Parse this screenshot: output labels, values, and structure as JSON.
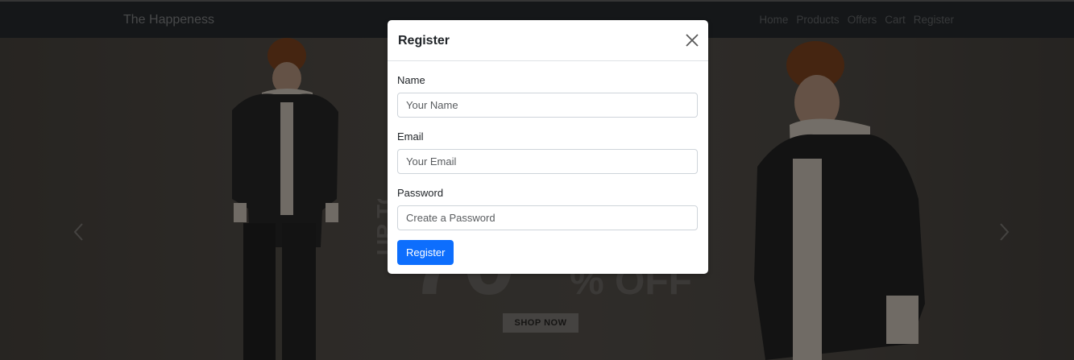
{
  "navbar": {
    "brand": "The Happeness",
    "links": [
      "Home",
      "Products",
      "Offers",
      "Cart",
      "Register"
    ]
  },
  "hero": {
    "banner_text_top": "UP TO",
    "banner_text_big": "70",
    "banner_text_off": "% OFF",
    "shop_now": "SHOP NOW",
    "prev_icon": "chevron-left-icon",
    "next_icon": "chevron-right-icon"
  },
  "modal": {
    "title": "Register",
    "close_icon": "close-icon",
    "fields": {
      "name": {
        "label": "Name",
        "placeholder": "Your Name"
      },
      "email": {
        "label": "Email",
        "placeholder": "Your Email"
      },
      "password": {
        "label": "Password",
        "placeholder": "Create a Password"
      }
    },
    "submit_label": "Register"
  },
  "colors": {
    "navbar_bg": "#2b2f33",
    "primary": "#0d6efd",
    "overlay": "rgba(0,0,0,0.5)"
  }
}
